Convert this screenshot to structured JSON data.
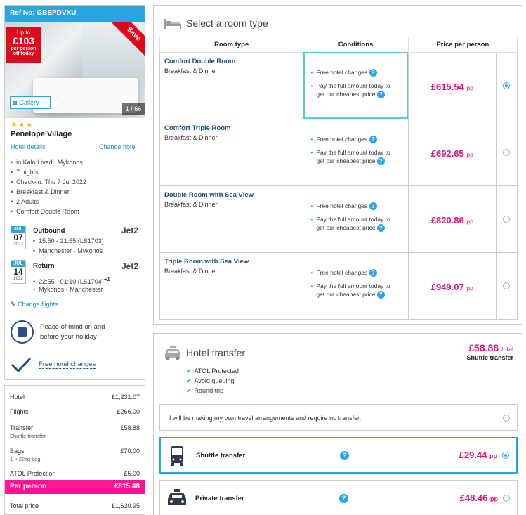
{
  "booking": {
    "ref": "Ref No: GBEPDVXU",
    "upto_line1": "Up to",
    "upto_amount": "£103",
    "upto_line2": "per person",
    "upto_line3": "off today",
    "save_ribbon": "Save",
    "gallery_label": "Gallery",
    "photo_counter": "1 / 66",
    "stars": "★★★",
    "hotel_name": "Penelope Village",
    "hotel_details_link": "Hotel details",
    "change_hotel_link": "Change hotel",
    "info": [
      "in Kalo Livadi, Mykonos",
      "7 nights",
      "Check-in: Thu 7 Jul 2022",
      "Breakfast & Dinner",
      "2 Adults",
      "Comfort Double Room"
    ],
    "outbound": {
      "month": "JUL",
      "day": "07",
      "year": "2022",
      "title": "Outbound",
      "time": "15:50 - 21:55 (LS1703)",
      "route": "Manchester - Mykonos",
      "airline": "Jet2"
    },
    "return": {
      "month": "JUL",
      "day": "14",
      "year": "2022",
      "title": "Return",
      "time": "22:55 - 01:10 (LS1704)",
      "plus": "+1",
      "route": "Mykonos - Manchester",
      "airline": "Jet2"
    },
    "change_flights_link": "Change flights",
    "peace_line1": "Peace of mind on and",
    "peace_line2": "before your holiday",
    "free_hotel_changes": "Free hotel changes"
  },
  "summary": {
    "hotel_label": "Hotel",
    "hotel_value": "£1,231.07",
    "flights_label": "Flights",
    "flights_value": "£266.00",
    "transfer_label": "Transfer",
    "transfer_value": "£58.88",
    "transfer_sub": "Shuttle transfer",
    "bags_label": "Bags",
    "bags_value": "£70.00",
    "bags_sub": "1 × 22kg bag",
    "atol_label": "ATOL Protection",
    "atol_value": "£5.00",
    "per_person_label": "Per person",
    "per_person_value": "£815.48",
    "total_label": "Total price",
    "total_value": "£1,630.95"
  },
  "rooms": {
    "title": "Select a room type",
    "col_room": "Room type",
    "col_conditions": "Conditions",
    "col_price": "Price per person",
    "cond1": "Free hotel changes",
    "cond2a": "Pay the full amount today to",
    "cond2b": "get our cheapest price",
    "pp_suffix": "pp",
    "list": [
      {
        "name": "Comfort Double Room",
        "board": "Breakfast & Dinner",
        "price": "£615.54"
      },
      {
        "name": "Comfort Triple Room",
        "board": "Breakfast & Dinner",
        "price": "£692.65"
      },
      {
        "name": "Double Room with Sea View",
        "board": "Breakfast & Dinner",
        "price": "£820.86"
      },
      {
        "name": "Triple Room with Sea View",
        "board": "Breakfast & Dinner",
        "price": "£949.07"
      }
    ]
  },
  "transfer": {
    "title": "Hotel transfer",
    "price": "£58.88",
    "price_suffix": "total",
    "price_label": "Shuttle transfer",
    "features": [
      "ATOL Protected",
      "Avoid queuing",
      "Round trip"
    ],
    "no_transfer": "I will be making my own travel arrangements and require no transfer.",
    "shuttle_label": "Shuttle transfer",
    "shuttle_price": "£29.44",
    "private_label": "Private transfer",
    "private_price": "£48.46",
    "pp_suffix": "pp"
  }
}
